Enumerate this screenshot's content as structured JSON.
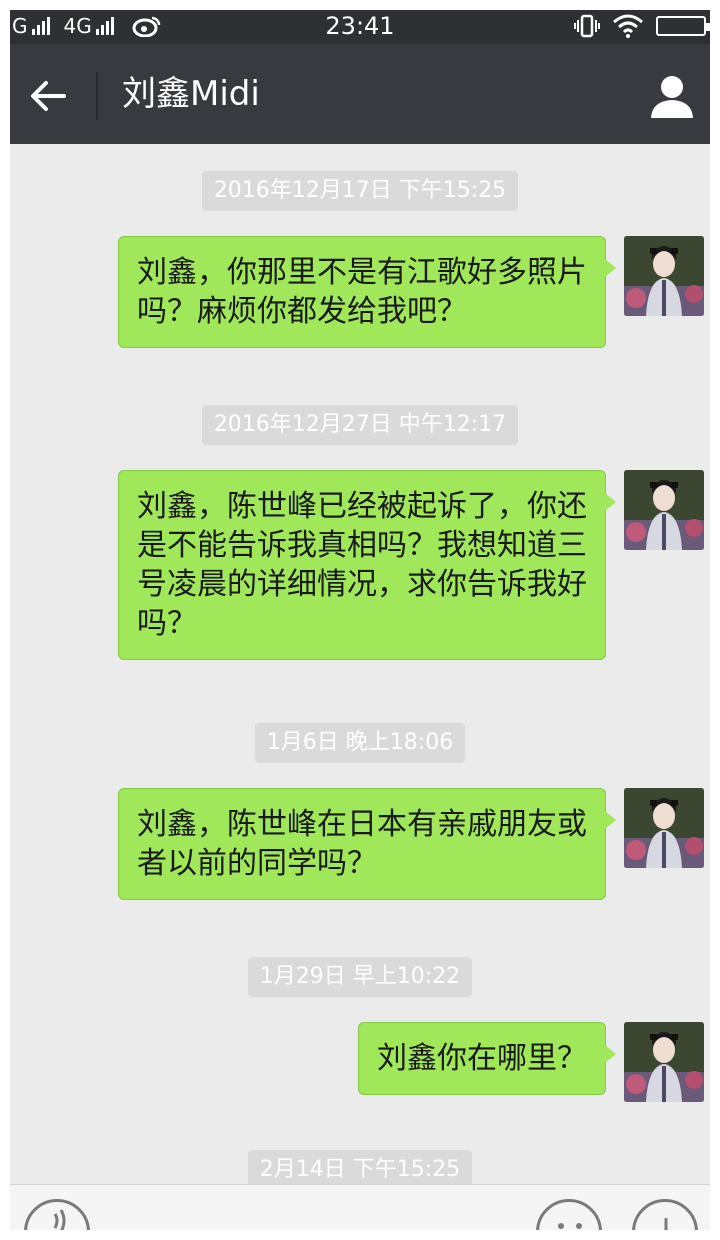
{
  "status_bar": {
    "carrier1": "G",
    "carrier2": "4G",
    "time": "23:41"
  },
  "header": {
    "title": "刘鑫Midi"
  },
  "messages": [
    {
      "timestamp": "2016年12月17日 下午15:25",
      "lines": [
        "刘鑫，你那里不是有江歌好多照片",
        "吗？麻烦你都发给我吧？"
      ]
    },
    {
      "timestamp": "2016年12月27日 中午12:17",
      "lines": [
        "刘鑫，陈世峰已经被起诉了，你还",
        "是不能告诉我真相吗？我想知道三",
        "号凌晨的详细情况，求你告诉我好",
        "吗？"
      ]
    },
    {
      "timestamp": "1月6日 晚上18:06",
      "lines": [
        "刘鑫，陈世峰在日本有亲戚朋友或",
        "者以前的同学吗？"
      ]
    },
    {
      "timestamp": "1月29日 早上10:22",
      "lines": [
        "刘鑫你在哪里？"
      ]
    }
  ],
  "last_timestamp": "2月14日 下午15:25",
  "icons": {
    "back": "back-arrow-icon",
    "profile": "person-icon",
    "voice": "voice-icon",
    "emoji": "emoji-icon",
    "more": "plus-icon"
  },
  "colors": {
    "bubble": "#a0e75a",
    "nav": "#393a3f",
    "background": "#ebebeb"
  }
}
